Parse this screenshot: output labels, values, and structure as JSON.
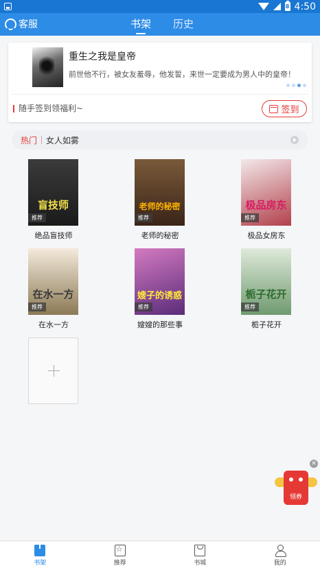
{
  "status_bar": {
    "time": "4:50",
    "battery_level": "8"
  },
  "header": {
    "service_label": "客服",
    "tabs": [
      {
        "label": "书架",
        "active": true
      },
      {
        "label": "历史",
        "active": false
      }
    ]
  },
  "recommend": {
    "title": "重生之我是皇帝",
    "description": "前世他不行，被女友羞辱，他发誓，来世一定要成为男人中的皇帝！",
    "carousel_pages": 4,
    "carousel_active": 3,
    "signin_prompt": "随手签到领福利~",
    "signin_label": "签到"
  },
  "hot": {
    "tag": "热门",
    "title": "女人如雾"
  },
  "books": [
    {
      "name": "绝品盲技师",
      "badge": "推荐",
      "cover_text": "盲技师",
      "colors": [
        "#3b3b3b",
        "#1a1a1a"
      ]
    },
    {
      "name": "老师的秘密",
      "badge": "推荐",
      "cover_text": "老师的秘密",
      "colors": [
        "#7a5a3a",
        "#3a2418"
      ]
    },
    {
      "name": "极品女房东",
      "badge": "推荐",
      "cover_text": "极品房东",
      "colors": [
        "#f2e8ea",
        "#b2404a"
      ]
    },
    {
      "name": "在水一方",
      "badge": "推荐",
      "cover_text": "在水一方",
      "colors": [
        "#f4eadc",
        "#8b7a55"
      ]
    },
    {
      "name": "嫂嫂的那些事",
      "badge": "推荐",
      "cover_text": "嫂子的诱惑",
      "colors": [
        "#d37ac0",
        "#5a2c7a"
      ]
    },
    {
      "name": "栀子花开",
      "badge": "推荐",
      "cover_text": "栀子花开",
      "colors": [
        "#dfe9da",
        "#6f9a6f"
      ]
    }
  ],
  "float": {
    "close_glyph": "✕",
    "coupon_label": "领券"
  },
  "bottom_nav": [
    {
      "label": "书架",
      "active": true
    },
    {
      "label": "推荐",
      "active": false
    },
    {
      "label": "书城",
      "active": false
    },
    {
      "label": "我的",
      "active": false
    }
  ],
  "colors": {
    "primary": "#2d8ce6",
    "status_bar": "#1976d2",
    "accent_red": "#e53935"
  },
  "icons": [
    "headset-icon",
    "calendar-icon",
    "arrow-right-icon",
    "plus-icon",
    "close-icon",
    "coupon-icon",
    "bookshelf-icon",
    "recommend-icon",
    "store-icon",
    "profile-icon"
  ]
}
